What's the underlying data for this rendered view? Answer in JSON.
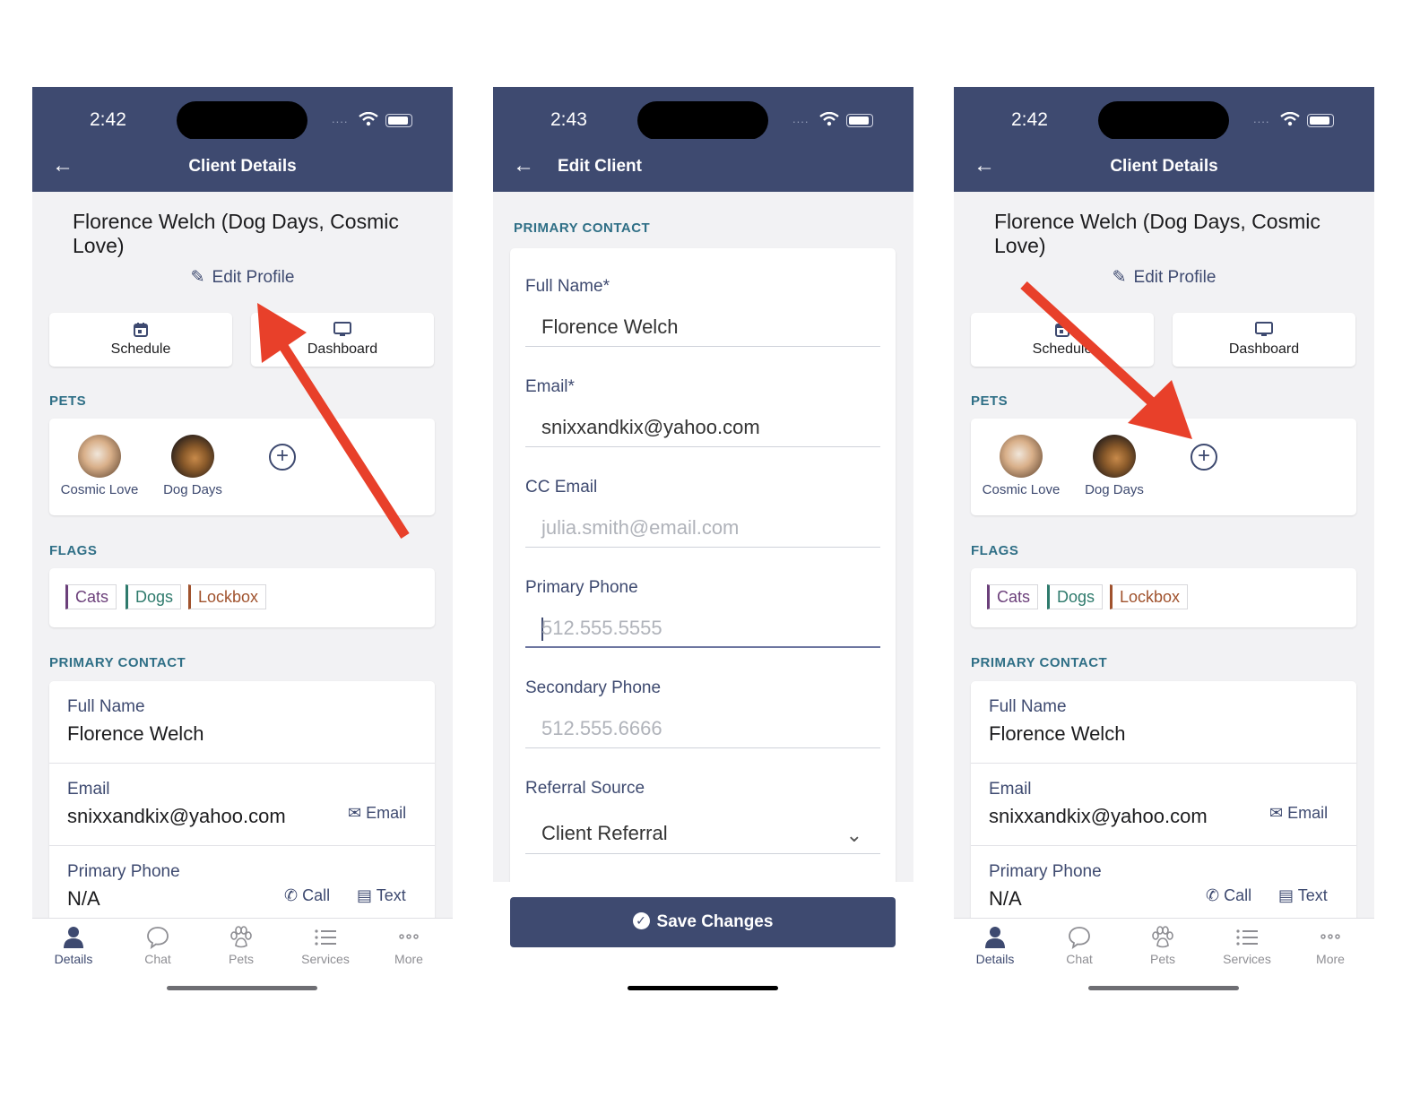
{
  "screens": [
    {
      "status_time": "2:42",
      "status_dots": "....",
      "nav_title": "Client Details",
      "client_name": "Florence Welch (Dog Days, Cosmic Love)",
      "edit_profile": "Edit Profile",
      "schedule": "Schedule",
      "dashboard": "Dashboard",
      "pets_header": "PETS",
      "pets": [
        "Cosmic Love",
        "Dog Days"
      ],
      "flags_header": "FLAGS",
      "flags": [
        "Cats",
        "Dogs",
        "Lockbox"
      ],
      "primary_contact_header": "PRIMARY CONTACT",
      "full_name_label": "Full Name",
      "full_name_value": "Florence Welch",
      "email_label": "Email",
      "email_value": "snixxandkix@yahoo.com",
      "email_action": "Email",
      "phone_label": "Primary Phone",
      "phone_value": "N/A",
      "call_action": "Call",
      "text_action": "Text",
      "tabs": [
        "Details",
        "Chat",
        "Pets",
        "Services",
        "More"
      ]
    },
    {
      "status_time": "2:43",
      "status_dots": "....",
      "nav_title": "Edit Client",
      "section_header": "PRIMARY CONTACT",
      "full_name_label": "Full Name*",
      "full_name_value": "Florence Welch",
      "email_label": "Email*",
      "email_value": "snixxandkix@yahoo.com",
      "cc_email_label": "CC Email",
      "cc_email_placeholder": "julia.smith@email.com",
      "primary_phone_label": "Primary Phone",
      "primary_phone_placeholder": "512.555.5555",
      "secondary_phone_label": "Secondary Phone",
      "secondary_phone_placeholder": "512.555.6666",
      "referral_label": "Referral Source",
      "referral_value": "Client Referral",
      "save_button": "Save Changes"
    },
    {
      "status_time": "2:42",
      "status_dots": "....",
      "nav_title": "Client Details",
      "client_name": "Florence Welch (Dog Days, Cosmic Love)",
      "edit_profile": "Edit Profile",
      "schedule": "Schedule",
      "dashboard": "Dashboard",
      "pets_header": "PETS",
      "pets": [
        "Cosmic Love",
        "Dog Days"
      ],
      "flags_header": "FLAGS",
      "flags": [
        "Cats",
        "Dogs",
        "Lockbox"
      ],
      "primary_contact_header": "PRIMARY CONTACT",
      "full_name_label": "Full Name",
      "full_name_value": "Florence Welch",
      "email_label": "Email",
      "email_value": "snixxandkix@yahoo.com",
      "email_action": "Email",
      "phone_label": "Primary Phone",
      "phone_value": "N/A",
      "call_action": "Call",
      "text_action": "Text",
      "tabs": [
        "Details",
        "Chat",
        "Pets",
        "Services",
        "More"
      ]
    }
  ],
  "colors": {
    "header": "#3e4a70",
    "accent_teal": "#2f6f86",
    "flag_cats": "#6b3f7a",
    "flag_dogs": "#2e7a6c",
    "flag_lockbox": "#a0522d",
    "annotation_arrow": "#e8402a"
  }
}
